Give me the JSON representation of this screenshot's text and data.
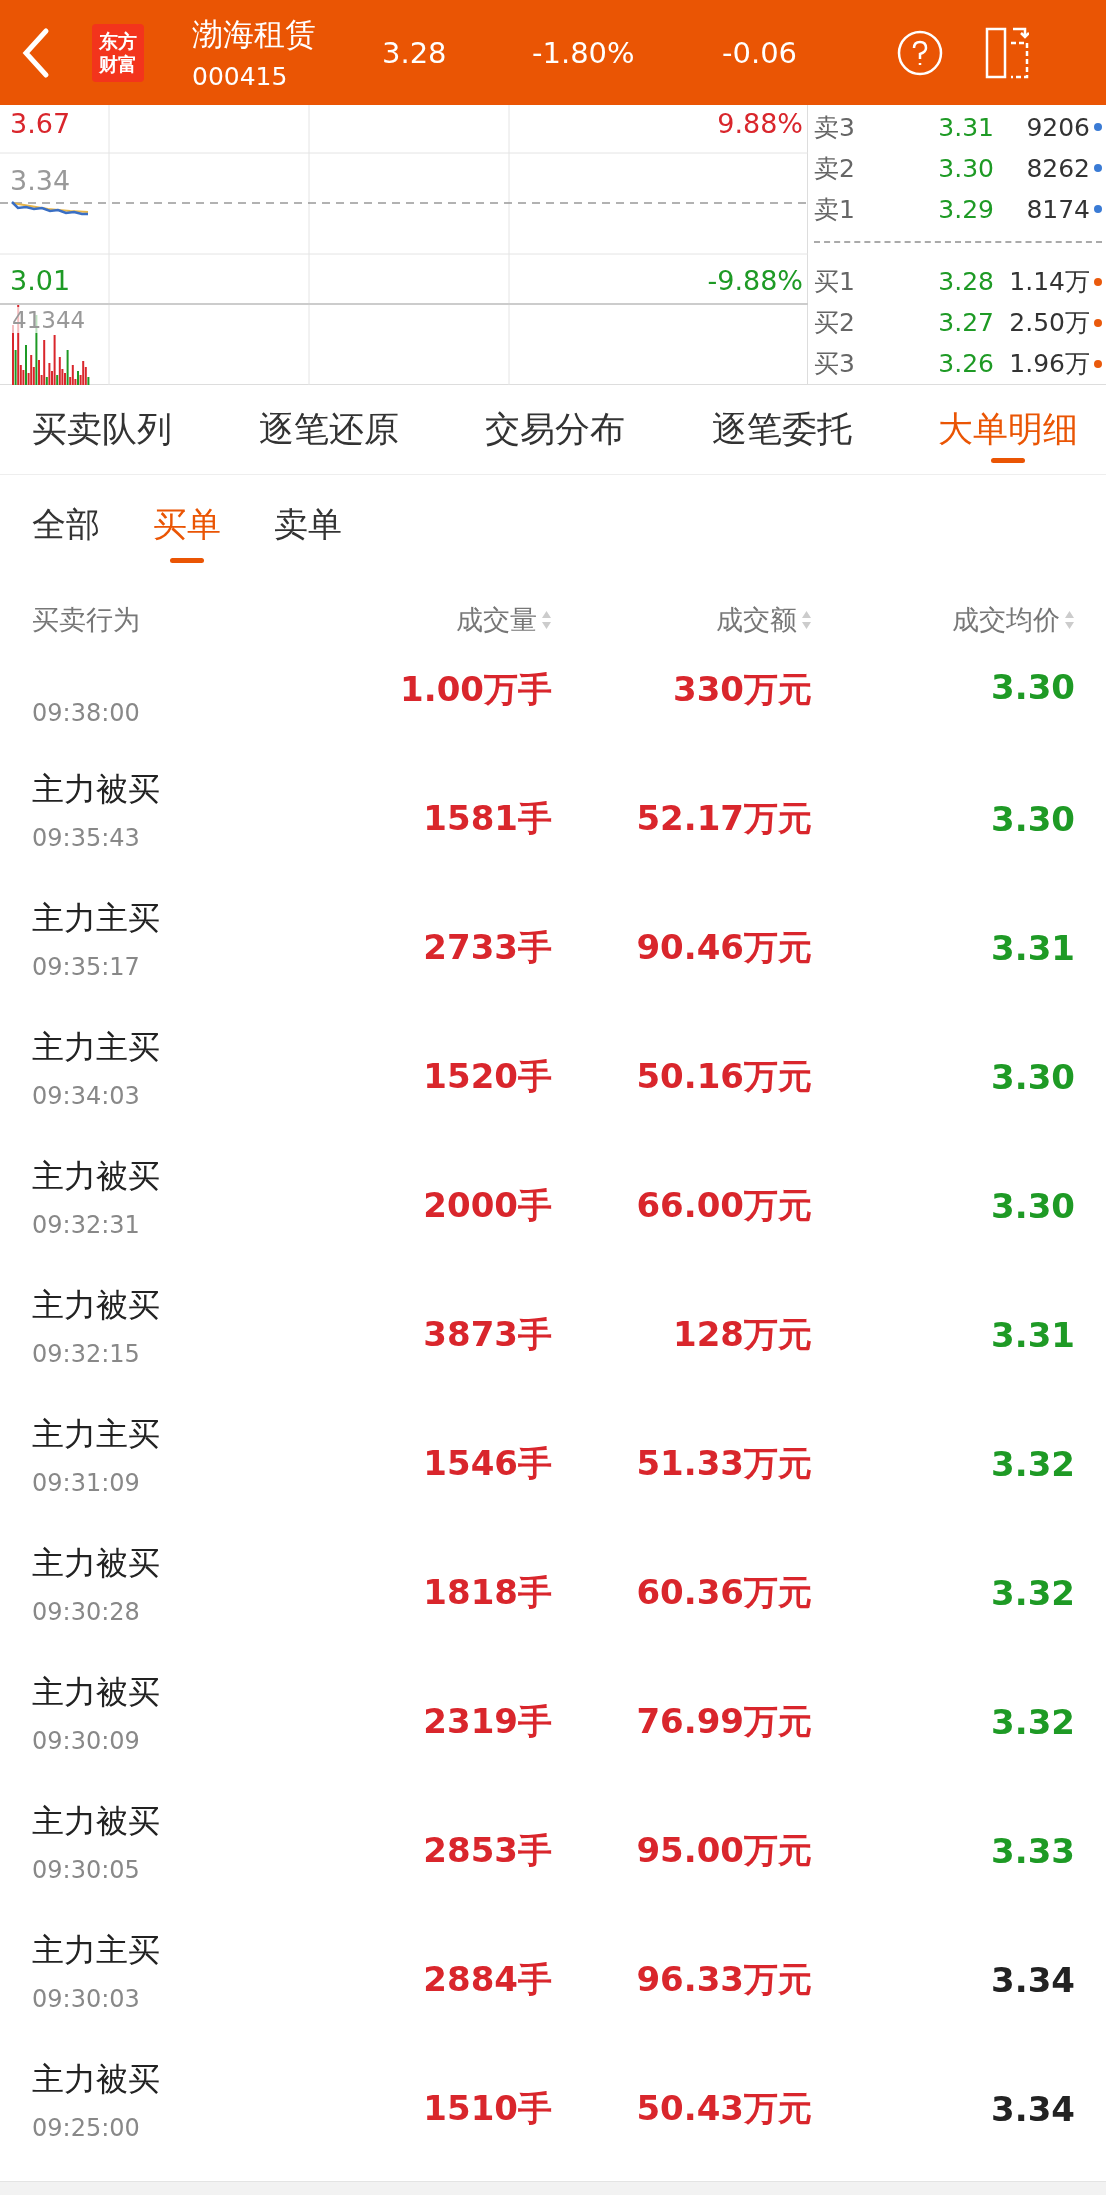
{
  "header": {
    "logo": [
      "东方",
      "财富"
    ],
    "name": "渤海租赁",
    "code": "000415",
    "price": "3.28",
    "change_pct": "-1.80%",
    "change": "-0.06"
  },
  "chart": {
    "high": "3.67",
    "high_pct": "9.88%",
    "mid": "3.34",
    "low": "3.01",
    "low_pct": "-9.88%",
    "volume": "41344"
  },
  "order_book": {
    "asks": [
      {
        "label": "卖3",
        "price": "3.31",
        "qty": "9206",
        "color": "#3a7bd5"
      },
      {
        "label": "卖2",
        "price": "3.30",
        "qty": "8262",
        "color": "#3a7bd5"
      },
      {
        "label": "卖1",
        "price": "3.29",
        "qty": "8174",
        "color": "#3a7bd5"
      }
    ],
    "bids": [
      {
        "label": "买1",
        "price": "3.28",
        "qty": "1.14万",
        "color": "#ea5a0c"
      },
      {
        "label": "买2",
        "price": "3.27",
        "qty": "2.50万",
        "color": "#ea5a0c"
      },
      {
        "label": "买3",
        "price": "3.26",
        "qty": "1.96万",
        "color": "#ea5a0c"
      }
    ]
  },
  "tabs": [
    {
      "label": "买卖队列",
      "selected": false
    },
    {
      "label": "逐笔还原",
      "selected": false
    },
    {
      "label": "交易分布",
      "selected": false
    },
    {
      "label": "逐笔委托",
      "selected": false
    },
    {
      "label": "大单明细",
      "selected": true
    }
  ],
  "filters": [
    {
      "label": "全部",
      "selected": false
    },
    {
      "label": "买单",
      "selected": true
    },
    {
      "label": "卖单",
      "selected": false
    }
  ],
  "table": {
    "columns": [
      "买卖行为",
      "成交量",
      "成交额",
      "成交均价"
    ],
    "rows": [
      {
        "time": "09:38:00",
        "volume": "1.00万手",
        "amount": "330万元",
        "price": "3.30",
        "color": "#1e9a25"
      },
      {
        "action": "主力被买",
        "time": "09:35:43",
        "volume": "1581手",
        "amount": "52.17万元",
        "price": "3.30",
        "color": "#1e9a25"
      },
      {
        "action": "主力主买",
        "time": "09:35:17",
        "volume": "2733手",
        "amount": "90.46万元",
        "price": "3.31",
        "color": "#1e9a25"
      },
      {
        "action": "主力主买",
        "time": "09:34:03",
        "volume": "1520手",
        "amount": "50.16万元",
        "price": "3.30",
        "color": "#1e9a25"
      },
      {
        "action": "主力被买",
        "time": "09:32:31",
        "volume": "2000手",
        "amount": "66.00万元",
        "price": "3.30",
        "color": "#1e9a25"
      },
      {
        "action": "主力被买",
        "time": "09:32:15",
        "volume": "3873手",
        "amount": "128万元",
        "price": "3.31",
        "color": "#1e9a25"
      },
      {
        "action": "主力主买",
        "time": "09:31:09",
        "volume": "1546手",
        "amount": "51.33万元",
        "price": "3.32",
        "color": "#1e9a25"
      },
      {
        "action": "主力被买",
        "time": "09:30:28",
        "volume": "1818手",
        "amount": "60.36万元",
        "price": "3.32",
        "color": "#1e9a25"
      },
      {
        "action": "主力被买",
        "time": "09:30:09",
        "volume": "2319手",
        "amount": "76.99万元",
        "price": "3.32",
        "color": "#1e9a25"
      },
      {
        "action": "主力被买",
        "time": "09:30:05",
        "volume": "2853手",
        "amount": "95.00万元",
        "price": "3.33",
        "color": "#1e9a25"
      },
      {
        "action": "主力主买",
        "time": "09:30:03",
        "volume": "2884手",
        "amount": "96.33万元",
        "price": "3.34",
        "color": "#222222"
      },
      {
        "action": "主力被买",
        "time": "09:25:00",
        "volume": "1510手",
        "amount": "50.43万元",
        "price": "3.34",
        "color": "#222222"
      }
    ]
  }
}
